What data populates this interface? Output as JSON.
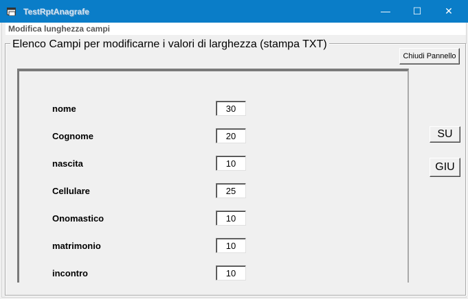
{
  "window": {
    "title": "TestRptAnagrafe",
    "minimize_glyph": "—",
    "maximize_glyph": "☐",
    "close_glyph": "✕"
  },
  "section": {
    "title": "Modifica lunghezza campi"
  },
  "group": {
    "caption": "Elenco Campi per modificarne i valori di larghezza (stampa TXT)"
  },
  "buttons": {
    "close_panel": "Chiudi Pannello",
    "up": "SU",
    "down": "GIU"
  },
  "fields": [
    {
      "label": "nome",
      "value": "30"
    },
    {
      "label": "Cognome",
      "value": "20"
    },
    {
      "label": "nascita",
      "value": "10"
    },
    {
      "label": "Cellulare",
      "value": "25"
    },
    {
      "label": "Onomastico",
      "value": "10"
    },
    {
      "label": "matrimonio",
      "value": "10"
    },
    {
      "label": "incontro",
      "value": "10"
    }
  ],
  "colors": {
    "titlebar": "#0a7dc8",
    "window_bg": "#f0f0f0"
  }
}
